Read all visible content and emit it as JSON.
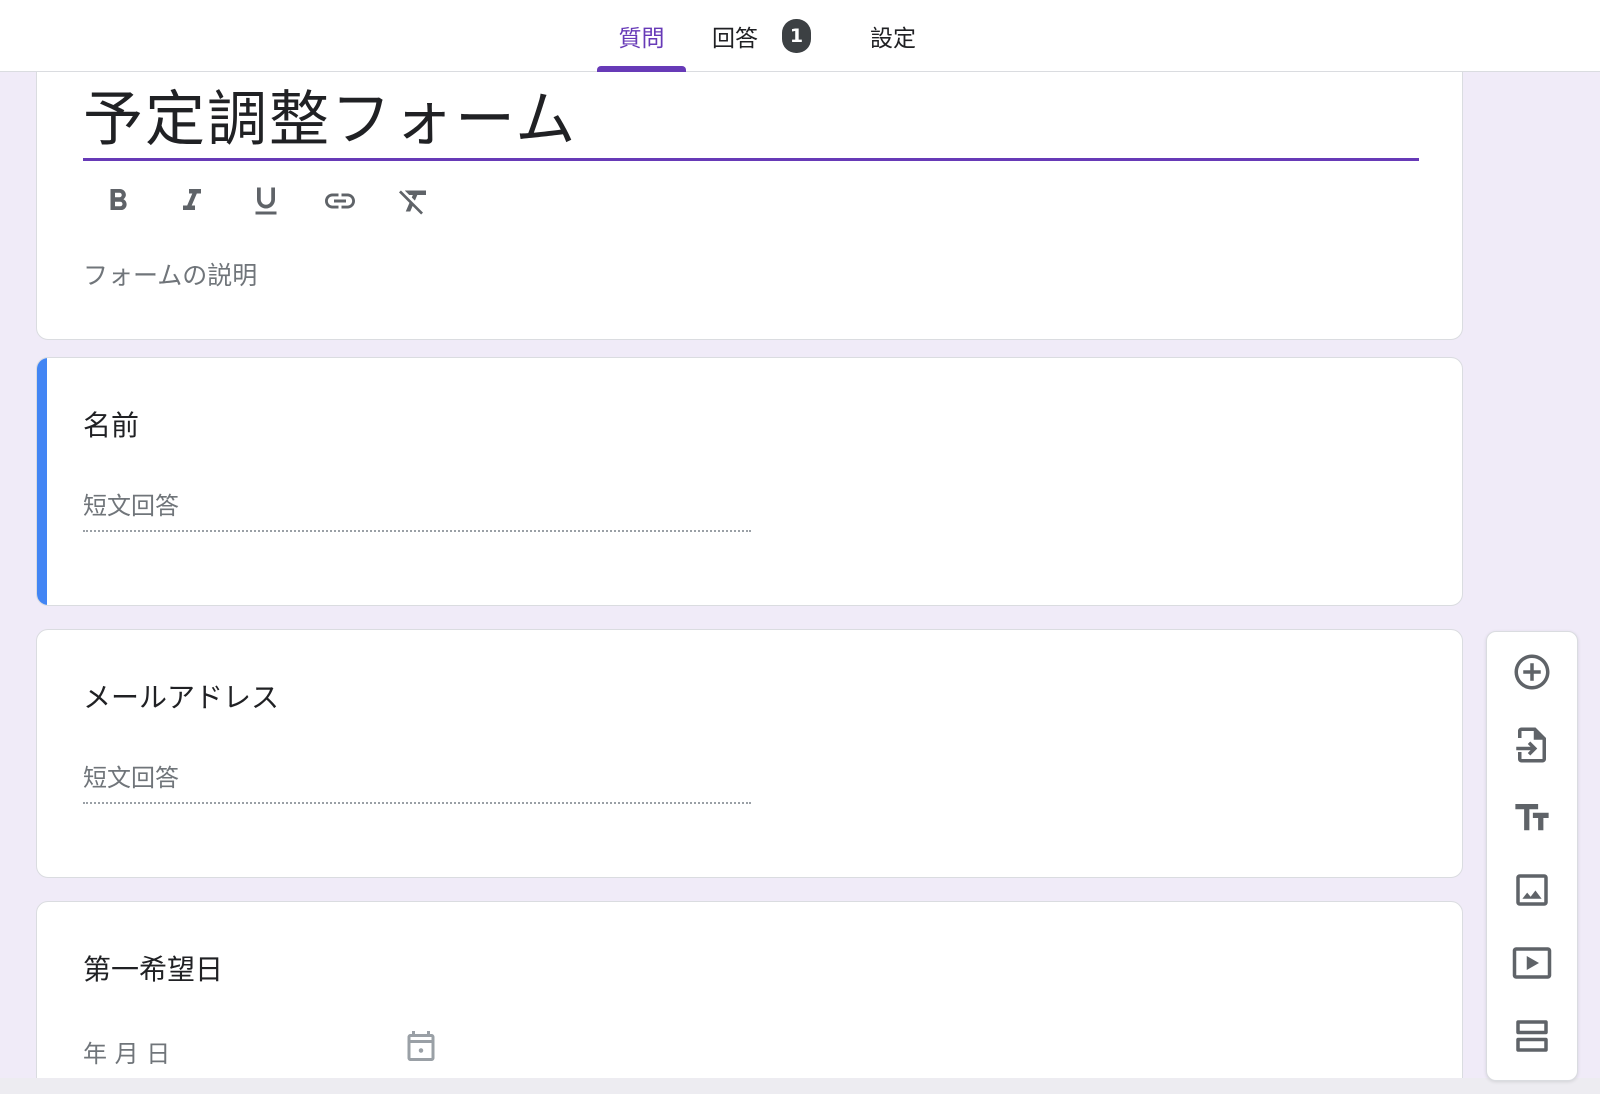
{
  "header": {
    "tabs": [
      {
        "label": "質問",
        "active": true
      },
      {
        "label": "回答",
        "badge": "1"
      },
      {
        "label": "設定"
      }
    ]
  },
  "form": {
    "title": "予定調整フォーム",
    "description_placeholder": "フォームの説明",
    "format_toolbar": [
      "bold-icon",
      "italic-icon",
      "underline-icon",
      "link-icon",
      "clear-format-icon"
    ]
  },
  "questions": [
    {
      "title": "名前",
      "answer_hint": "短文回答"
    },
    {
      "title": "メールアドレス",
      "answer_hint": "短文回答"
    },
    {
      "title": "第一希望日",
      "date_hint": "年 月 日"
    }
  ],
  "side_toolbar": [
    "add-question-icon",
    "import-questions-icon",
    "add-title-icon",
    "add-image-icon",
    "add-video-icon",
    "add-section-icon"
  ],
  "colors": {
    "accent": "#673ab7",
    "active_card": "#4285f4",
    "background": "#f0ebf8"
  }
}
